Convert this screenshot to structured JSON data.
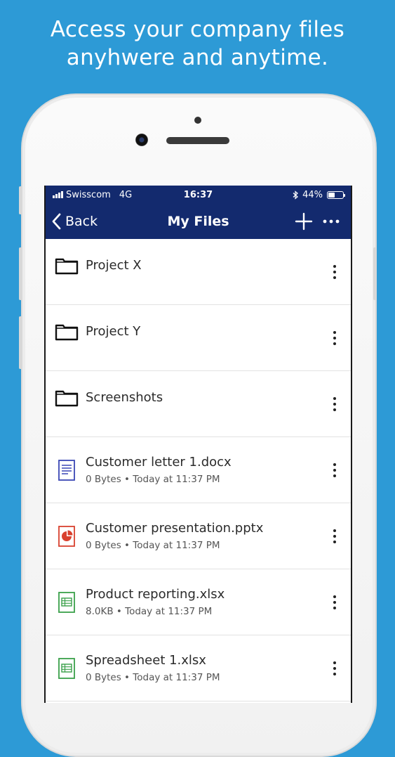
{
  "promo": {
    "line1": "Access your company files",
    "line2": "anyhwere and anytime."
  },
  "status_bar": {
    "carrier": "Swisscom",
    "network": "4G",
    "time": "16:37",
    "battery": "44%",
    "battery_level": 0.44,
    "bluetooth_icon": "bluetooth-icon"
  },
  "nav": {
    "back_label": "Back",
    "title": "My Files",
    "add_icon": "plus-icon",
    "more_icon": "ellipsis-icon"
  },
  "colors": {
    "background": "#2d9ad6",
    "nav_bar": "#132a6e",
    "doc_icon": "#3a47b5",
    "ppt_icon": "#d9412f",
    "xls_icon": "#3aa04a"
  },
  "files": [
    {
      "name": "Project X",
      "meta": "",
      "icon": "folder-icon"
    },
    {
      "name": "Project Y",
      "meta": "",
      "icon": "folder-icon"
    },
    {
      "name": "Screenshots",
      "meta": "",
      "icon": "folder-icon"
    },
    {
      "name": "Customer letter 1.docx",
      "meta": "0 Bytes • Today at 11:37 PM",
      "icon": "word-document-icon"
    },
    {
      "name": "Customer presentation.pptx",
      "meta": "0 Bytes • Today at 11:37 PM",
      "icon": "powerpoint-icon"
    },
    {
      "name": "Product reporting.xlsx",
      "meta": "8.0KB • Today at 11:37 PM",
      "icon": "spreadsheet-icon"
    },
    {
      "name": "Spreadsheet 1.xlsx",
      "meta": "0 Bytes • Today at 11:37 PM",
      "icon": "spreadsheet-icon"
    }
  ]
}
